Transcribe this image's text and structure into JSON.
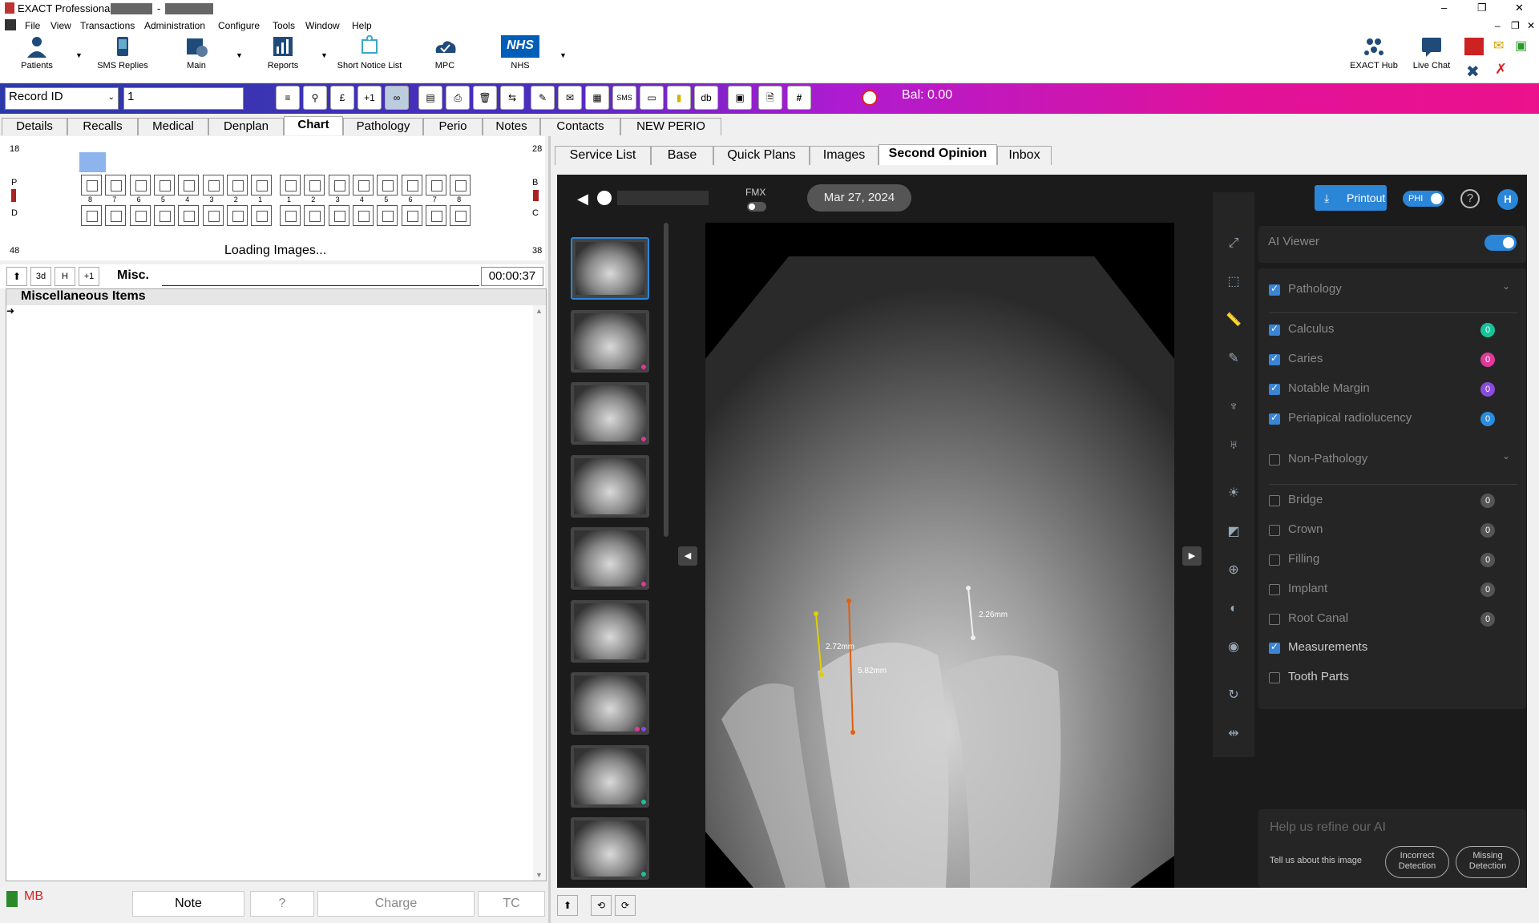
{
  "window": {
    "title": "EXACT Professional <",
    "title_sep": "-"
  },
  "menu": [
    "File",
    "View",
    "Transactions",
    "Administration",
    "Configure",
    "Tools",
    "Window",
    "Help"
  ],
  "toolbar": {
    "patients": "Patients",
    "sms": "SMS Replies",
    "main": "Main",
    "reports": "Reports",
    "short_notice": "Short Notice List",
    "mpc": "MPC",
    "nhs": "NHS",
    "nhs_logo": "NHS",
    "exact_hub": "EXACT Hub",
    "live_chat": "Live Chat"
  },
  "search": {
    "field": "Record ID",
    "value": "1",
    "balance": "Bal: 0.00"
  },
  "tabs": [
    "Details",
    "Recalls",
    "Medical",
    "Denplan",
    "Chart",
    "Pathology",
    "Perio",
    "Notes",
    "Contacts",
    "NEW PERIO"
  ],
  "chart": {
    "upper_left_num": "18",
    "upper_right_num": "28",
    "lower_left_num": "48",
    "lower_right_num": "38",
    "left_letters": [
      "P",
      "D"
    ],
    "right_letters": [
      "B",
      "C"
    ],
    "upper_labels": [
      "8",
      "7",
      "6",
      "5",
      "4",
      "3",
      "2",
      "1",
      "1",
      "2",
      "3",
      "4",
      "5",
      "6",
      "7",
      "8"
    ],
    "status": "Loading Images..."
  },
  "misc": {
    "btn_3d": "3d",
    "btn_h": "H",
    "btn_plus": "+1",
    "tab": "Misc.",
    "timer": "00:00:37",
    "heading": "Miscellaneous Items"
  },
  "bottom": {
    "mb": "MB",
    "note": "Note",
    "query": "?",
    "charge": "Charge",
    "tc": "TC"
  },
  "tabs2": [
    "Service List",
    "Base",
    "Quick Plans",
    "Images",
    "Second Opinion",
    "Inbox"
  ],
  "viewer": {
    "fmx": "FMX",
    "date": "Mar 27, 2024",
    "printout": "Printout",
    "phi": "PHI",
    "help": "?",
    "avatar": "H",
    "measurements": [
      {
        "label": "2.72mm"
      },
      {
        "label": "5.82mm"
      },
      {
        "label": "2.26mm"
      }
    ]
  },
  "ai": {
    "viewer_label": "AI Viewer",
    "pathology": "Pathology",
    "pathology_items": [
      {
        "label": "Calculus",
        "count": "0",
        "color": "#19c39a"
      },
      {
        "label": "Caries",
        "count": "0",
        "color": "#e0399a"
      },
      {
        "label": "Notable Margin",
        "count": "0",
        "color": "#8a4be0"
      },
      {
        "label": "Periapical radiolucency",
        "count": "0",
        "color": "#2a8de0"
      }
    ],
    "non_pathology": "Non-Pathology",
    "non_items": [
      {
        "label": "Bridge",
        "count": "0"
      },
      {
        "label": "Crown",
        "count": "0"
      },
      {
        "label": "Filling",
        "count": "0"
      },
      {
        "label": "Implant",
        "count": "0"
      },
      {
        "label": "Root Canal",
        "count": "0"
      }
    ],
    "measurements": "Measurements",
    "tooth_parts": "Tooth Parts",
    "refine": "Help us refine our AI",
    "tell": "Tell us about this image",
    "incorrect": "Incorrect Detection",
    "missing": "Missing Detection"
  }
}
